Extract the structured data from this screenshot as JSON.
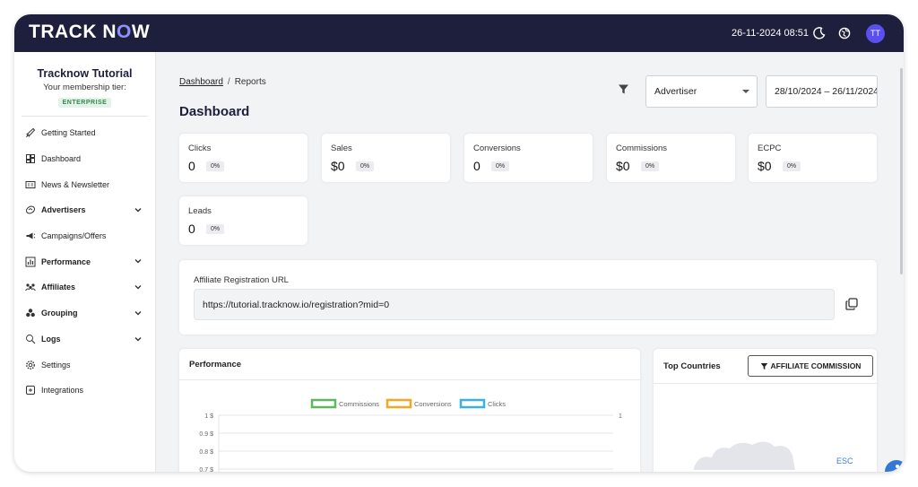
{
  "topbar": {
    "logo_left": "TRACK N",
    "logo_accent": "O",
    "logo_right": "W",
    "datetime": "26-11-2024 08:51",
    "avatar_initials": "TT"
  },
  "sidebar": {
    "org_name": "Tracknow Tutorial",
    "tier_label": "Your membership tier:",
    "tier_badge": "ENTERPRISE",
    "items": [
      {
        "label": "Getting Started",
        "icon": "rocket-icon",
        "bold": false,
        "expandable": false
      },
      {
        "label": "Dashboard",
        "icon": "dashboard-icon",
        "bold": false,
        "expandable": false
      },
      {
        "label": "News & Newsletter",
        "icon": "newspaper-icon",
        "bold": false,
        "expandable": false
      },
      {
        "label": "Advertisers",
        "icon": "handshake-icon",
        "bold": true,
        "expandable": true
      },
      {
        "label": "Campaigns/Offers",
        "icon": "megaphone-icon",
        "bold": false,
        "expandable": false
      },
      {
        "label": "Performance",
        "icon": "bar-chart-icon",
        "bold": true,
        "expandable": true
      },
      {
        "label": "Affiliates",
        "icon": "users-icon",
        "bold": true,
        "expandable": true
      },
      {
        "label": "Grouping",
        "icon": "group-icon",
        "bold": true,
        "expandable": true
      },
      {
        "label": "Logs",
        "icon": "magnifier-icon",
        "bold": true,
        "expandable": true
      },
      {
        "label": "Settings",
        "icon": "gear-icon",
        "bold": false,
        "expandable": false
      },
      {
        "label": "Integrations",
        "icon": "integrations-icon",
        "bold": false,
        "expandable": false
      }
    ]
  },
  "main": {
    "breadcrumb_link": "Dashboard",
    "breadcrumb_sep": "/",
    "breadcrumb_current": "Reports",
    "title": "Dashboard",
    "advertiser_select": "Advertiser",
    "date_range": "28/10/2024 – 26/11/2024"
  },
  "stats": [
    {
      "label": "Clicks",
      "value": "0",
      "pct": "0%"
    },
    {
      "label": "Sales",
      "value": "$0",
      "pct": "0%"
    },
    {
      "label": "Conversions",
      "value": "0",
      "pct": "0%"
    },
    {
      "label": "Commissions",
      "value": "$0",
      "pct": "0%"
    },
    {
      "label": "ECPC",
      "value": "$0",
      "pct": "0%"
    },
    {
      "label": "Leads",
      "value": "0",
      "pct": "0%"
    }
  ],
  "registration": {
    "label": "Affiliate Registration URL",
    "url": "https://tutorial.tracknow.io/registration?mid=0"
  },
  "performance": {
    "title": "Performance"
  },
  "chart_data": {
    "type": "line",
    "series": [
      {
        "name": "Commissions",
        "color": "#5cb85c",
        "values": []
      },
      {
        "name": "Conversions",
        "color": "#f5a623",
        "values": []
      },
      {
        "name": "Clicks",
        "color": "#3bb0e8",
        "values": []
      }
    ],
    "y_left_ticks": [
      "1 $",
      "0.9 $",
      "0.8 $",
      "0.7 $"
    ],
    "y_right_ticks": [
      "1"
    ],
    "legend": "top-center",
    "grid": true
  },
  "top_countries": {
    "title": "Top Countries",
    "button": "AFFILIATE COMMISSION",
    "esc": "ESC"
  },
  "colors": {
    "topbar": "#1e1f3d",
    "accent": "#5b4ff0",
    "a11y": "#3478d6"
  }
}
